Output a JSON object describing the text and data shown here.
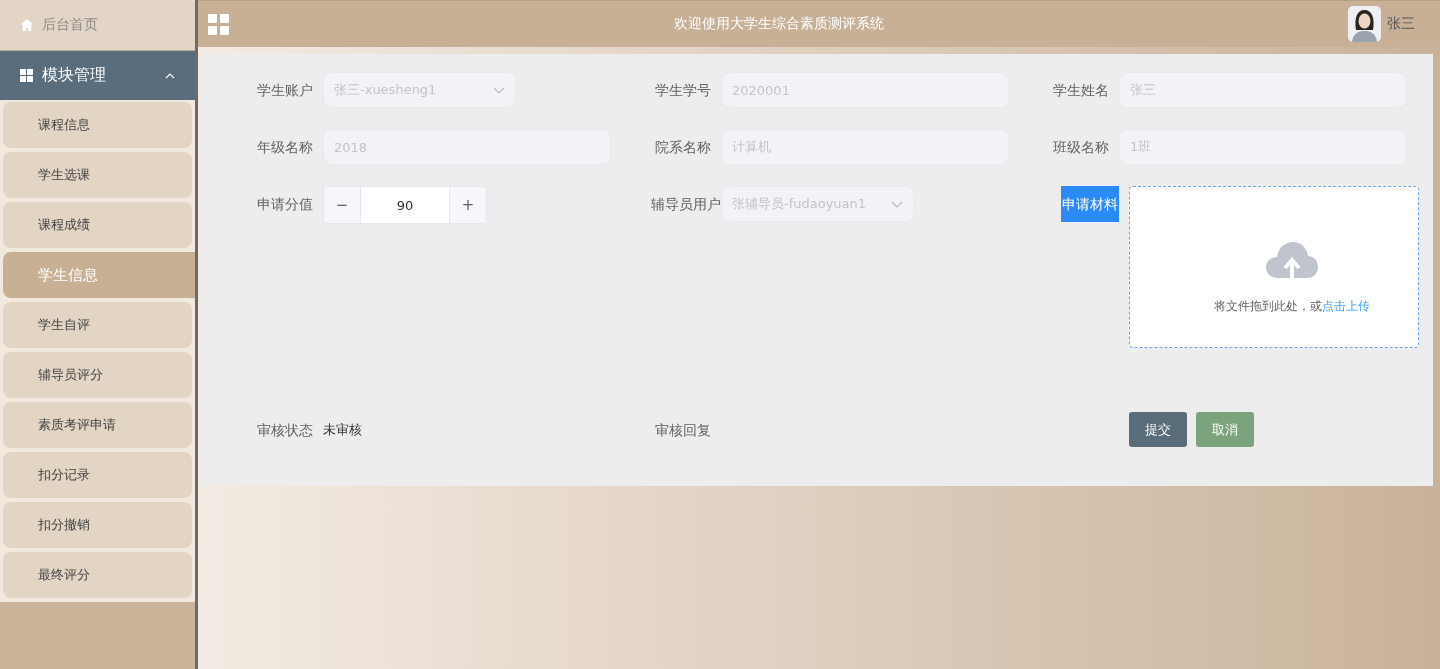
{
  "sidebar": {
    "home": {
      "label": "后台首页"
    },
    "group": {
      "label": "模块管理",
      "expanded": true,
      "items": [
        {
          "label": "课程信息",
          "selected": false
        },
        {
          "label": "学生选课",
          "selected": false
        },
        {
          "label": "课程成绩",
          "selected": false
        },
        {
          "label": "学生信息",
          "selected": true
        },
        {
          "label": "学生自评",
          "selected": false
        },
        {
          "label": "辅导员评分",
          "selected": false
        },
        {
          "label": "素质考评申请",
          "selected": false
        },
        {
          "label": "扣分记录",
          "selected": false
        },
        {
          "label": "扣分撤销",
          "selected": false
        },
        {
          "label": "最终评分",
          "selected": false
        }
      ]
    }
  },
  "header": {
    "title": "欢迎使用大学生综合素质测评系统",
    "user_name": "张三"
  },
  "form": {
    "fields": [
      {
        "kind": "select",
        "label": "学生账户",
        "value": "张三-xuesheng1",
        "disabled": true
      },
      {
        "kind": "text",
        "label": "学生学号",
        "value": "2020001",
        "disabled": true
      },
      {
        "kind": "text",
        "label": "学生姓名",
        "value": "张三",
        "disabled": true
      },
      {
        "kind": "text",
        "label": "年级名称",
        "value": "2018",
        "disabled": true
      },
      {
        "kind": "text",
        "label": "院系名称",
        "value": "计算机",
        "disabled": true
      },
      {
        "kind": "text",
        "label": "班级名称",
        "value": "1班",
        "disabled": true
      },
      {
        "kind": "number",
        "label": "申请分值",
        "value": "90",
        "minus": "−",
        "plus": "+"
      },
      {
        "kind": "select",
        "label": "辅导员用户",
        "value": "张辅导员-fudaoyuan1",
        "disabled": true
      },
      {
        "kind": "upload",
        "label": "申请材料",
        "highlighted": true,
        "hint": "将文件拖到此处，或",
        "link": "点击上传"
      },
      {
        "kind": "static",
        "label": "审核状态",
        "value": "未审核"
      },
      {
        "kind": "static",
        "label": "审核回复"
      }
    ],
    "buttons": [
      {
        "label": "提交",
        "kind": "primary"
      },
      {
        "label": "取消",
        "kind": "secondary"
      }
    ]
  }
}
